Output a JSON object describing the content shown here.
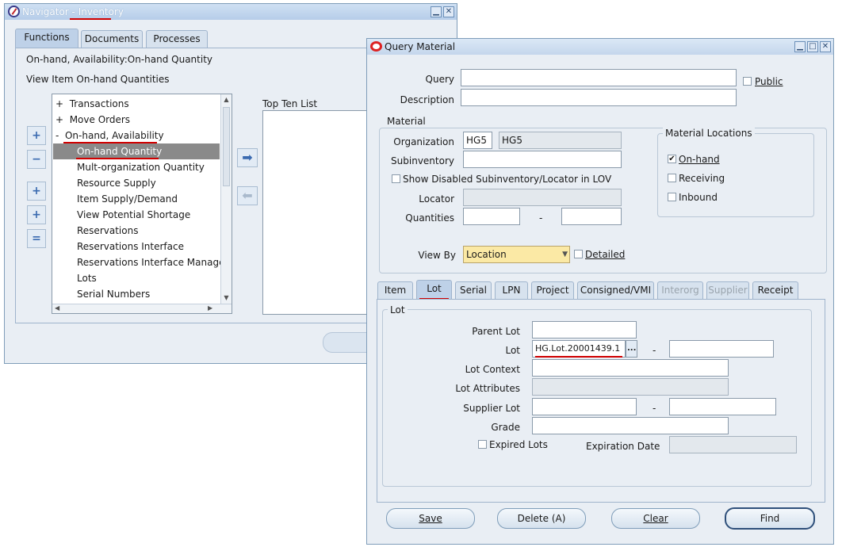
{
  "navigator": {
    "title_prefix": "Navigator - ",
    "title_app": "Inventory",
    "tabs": [
      "Functions",
      "Documents",
      "Processes"
    ],
    "breadcrumb": "On-hand, Availability:On-hand Quantity",
    "description": "View Item On-hand Quantities",
    "tree": [
      {
        "prefix": "+",
        "label": "Transactions"
      },
      {
        "prefix": "+",
        "label": "Move Orders"
      },
      {
        "prefix": "-",
        "label": "On-hand, Availability"
      },
      {
        "prefix": "",
        "label": "On-hand Quantity"
      },
      {
        "prefix": "",
        "label": "Mult-organization Quantity"
      },
      {
        "prefix": "",
        "label": "Resource Supply"
      },
      {
        "prefix": "",
        "label": "Item Supply/Demand"
      },
      {
        "prefix": "",
        "label": "View Potential Shortage"
      },
      {
        "prefix": "",
        "label": "Reservations"
      },
      {
        "prefix": "",
        "label": "Reservations Interface"
      },
      {
        "prefix": "",
        "label": "Reservations Interface Manager"
      },
      {
        "prefix": "",
        "label": "Lots"
      },
      {
        "prefix": "",
        "label": "Serial Numbers"
      }
    ],
    "top_ten_label": "Top Ten List"
  },
  "query": {
    "title": "Query Material",
    "query_label": "Query",
    "public_label": "Public",
    "description_label": "Description",
    "material_group": "Material",
    "organization_label": "Organization",
    "organization_code": "HG5",
    "organization_name": "HG5",
    "subinventory_label": "Subinventory",
    "show_disabled_label": "Show Disabled Subinventory/Locator in LOV",
    "locator_label": "Locator",
    "quantities_label": "Quantities",
    "dash": "-",
    "locations_group": "Material Locations",
    "onhand_label": "On-hand",
    "receiving_label": "Receiving",
    "inbound_label": "Inbound",
    "view_by_label": "View By",
    "view_by_value": "Location",
    "detailed_label": "Detailed",
    "tabs": [
      {
        "label": "Item",
        "state": "normal"
      },
      {
        "label": "Lot",
        "state": "active"
      },
      {
        "label": "Serial",
        "state": "normal"
      },
      {
        "label": "LPN",
        "state": "normal"
      },
      {
        "label": "Project",
        "state": "normal"
      },
      {
        "label": "Consigned/VMI",
        "state": "normal"
      },
      {
        "label": "Interorg",
        "state": "disabled"
      },
      {
        "label": "Supplier",
        "state": "disabled"
      },
      {
        "label": "Receipt",
        "state": "normal"
      }
    ],
    "lot_group": "Lot",
    "parent_lot_label": "Parent Lot",
    "lot_label": "Lot",
    "lot_value": "HG.Lot.20001439.1",
    "lot_lov": "...",
    "lot_context_label": "Lot Context",
    "lot_attributes_label": "Lot Attributes",
    "supplier_lot_label": "Supplier Lot",
    "grade_label": "Grade",
    "expired_lots_label": "Expired Lots",
    "expiration_date_label": "Expiration Date",
    "buttons": {
      "save": "Save",
      "delete": "Delete (A)",
      "clear": "Clear",
      "find": "Find"
    }
  },
  "colors": {
    "highlight": "#8a8a8a",
    "annotation": "#d00000",
    "view_by_bg": "#fbe9a5"
  }
}
